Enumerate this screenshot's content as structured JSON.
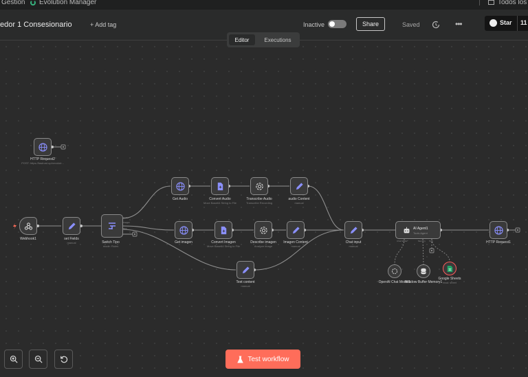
{
  "topstrip": {
    "crumb": "Gestion",
    "project": "Evolution Manager",
    "right": "Todos los"
  },
  "header": {
    "workflow_title": "edor 1 Consesionario",
    "add_tag": "+ Add tag",
    "status_label": "Inactive",
    "share_label": "Share",
    "saved_label": "Saved",
    "star_label": "Star",
    "star_count": "11"
  },
  "tabs": [
    "Editor",
    "Executions"
  ],
  "nodes": {
    "http_request2": {
      "name": "HTTP Request2",
      "sub": "POST: https://fastrust.up/xevolutr..."
    },
    "webhook1": {
      "name": "Webhook1"
    },
    "set_fields": {
      "name": "set Fields",
      "sub": "manual"
    },
    "switch_tipo": {
      "name": "Switch Tipo",
      "sub": "mode: Rules"
    },
    "get_audio": {
      "name": "Get Audio"
    },
    "convert_audio": {
      "name": "Convert Audio",
      "sub": "Move Base64 String to File"
    },
    "transcribe_audio": {
      "name": "Transcribe Audio",
      "sub": "Transcribe Recording"
    },
    "audio_content": {
      "name": "audio Content",
      "sub": "manual"
    },
    "get_imagen": {
      "name": "Get imagen"
    },
    "convert_imagen": {
      "name": "Convert Imagen",
      "sub": "Move Base64 String to File"
    },
    "describe_imagen": {
      "name": "Describe imagen",
      "sub": "Analyze image"
    },
    "imagen_content": {
      "name": "Imagen Content",
      "sub": "manual"
    },
    "text_content": {
      "name": "Text content",
      "sub": "manual"
    },
    "chat_input": {
      "name": "Chat input",
      "sub": "manual"
    },
    "ai_agent1": {
      "name": "AI Agent1",
      "sub": "Tools Agent"
    },
    "http_request1": {
      "name": "HTTP Request1"
    },
    "openai_model": {
      "name": "OpenAI Chat Model1"
    },
    "window_memory": {
      "name": "Window Buffer Memory1"
    },
    "google_sheets": {
      "name": "Google Sheets",
      "sub": "read: sheet"
    }
  },
  "agent_ports": {
    "chat_model": "Chat Model*",
    "memory": "Memory",
    "tool": "Tool"
  },
  "switch_outputs": [
    "Audio",
    "Imagen",
    "Text"
  ],
  "test_workflow_label": "Test workflow",
  "colors": {
    "accent": "#ff6d5a",
    "canvas": "#2b2b2b",
    "node_icon": "#8b90ff"
  }
}
